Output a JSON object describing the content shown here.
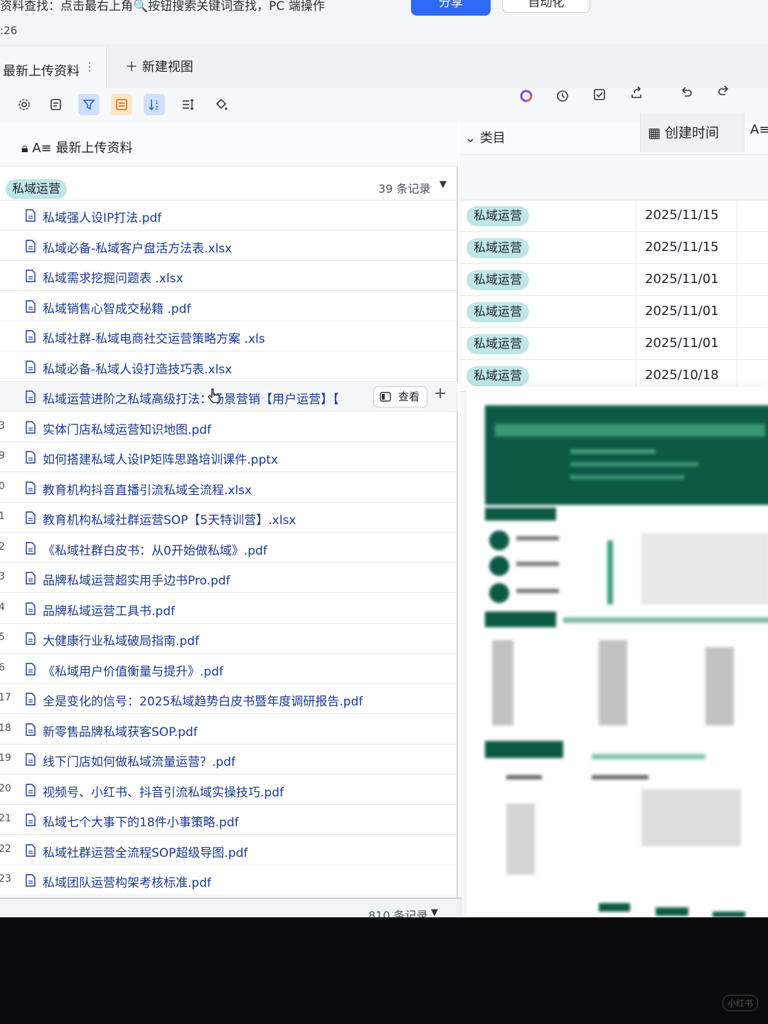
{
  "top": {
    "hint": "资料查找：点击最右上角🔍按钮搜索关键词查找，PC 端操作",
    "time": ":26",
    "share_label": "分享",
    "auto_label": "自动化"
  },
  "view": {
    "tab_label": "最新上传资料",
    "tab_more": "⋮",
    "new_view_label": "＋ 新建视图"
  },
  "table": {
    "primary_column": "最新上传资料",
    "columns": {
      "category": "类目",
      "created": "创建时间",
      "extra": "A≡"
    },
    "group": {
      "name": "私域运营",
      "count": "39 条记录"
    },
    "hover_view_label": "查看",
    "rows": [
      {
        "num": "",
        "name": "私域强人设IP打法.pdf",
        "category": "私域运营",
        "date": "2025/11/15"
      },
      {
        "num": "",
        "name": "私域必备-私域客户盘活方法表.xlsx",
        "category": "私域运营",
        "date": "2025/11/15"
      },
      {
        "num": "",
        "name": "私域需求挖掘问题表 .xlsx",
        "category": "私域运营",
        "date": "2025/11/01"
      },
      {
        "num": "",
        "name": "私域销售心智成交秘籍 .pdf",
        "category": "私域运营",
        "date": "2025/11/01"
      },
      {
        "num": "",
        "name": "私域社群-私域电商社交运营策略方案 .xls",
        "category": "私域运营",
        "date": "2025/11/01"
      },
      {
        "num": "",
        "name": "私域必备-私域人设打造技巧表.xlsx",
        "category": "私域运营",
        "date": "2025/10/18"
      },
      {
        "num": "",
        "name": "私域运营进阶之私域高级打法：场景营销【用户运营】【",
        "category": "",
        "date": ""
      },
      {
        "num": "3",
        "name": "实体门店私域运营知识地图.pdf",
        "category": "",
        "date": ""
      },
      {
        "num": "9",
        "name": "如何搭建私域人设IP矩阵思路培训课件.pptx",
        "category": "",
        "date": ""
      },
      {
        "num": "0",
        "name": "教育机构抖音直播引流私域全流程.xlsx",
        "category": "",
        "date": ""
      },
      {
        "num": "1",
        "name": "教育机构私域社群运营SOP【5天特训营】.xlsx",
        "category": "",
        "date": ""
      },
      {
        "num": "2",
        "name": "《私域社群白皮书：从0开始做私域》.pdf",
        "category": "",
        "date": ""
      },
      {
        "num": "3",
        "name": "品牌私域运营超实用手边书Pro.pdf",
        "category": "",
        "date": ""
      },
      {
        "num": "4",
        "name": "品牌私域运营工具书.pdf",
        "category": "",
        "date": ""
      },
      {
        "num": "5",
        "name": "大健康行业私域破局指南.pdf",
        "category": "",
        "date": ""
      },
      {
        "num": "6",
        "name": "《私域用户价值衡量与提升》.pdf",
        "category": "",
        "date": ""
      },
      {
        "num": "17",
        "name": "全是变化的信号：2025私域趋势白皮书暨年度调研报告.pdf",
        "category": "",
        "date": ""
      },
      {
        "num": "18",
        "name": "新零售品牌私域获客SOP.pdf",
        "category": "",
        "date": ""
      },
      {
        "num": "19",
        "name": "线下门店如何做私域流量运营？.pdf",
        "category": "",
        "date": ""
      },
      {
        "num": "20",
        "name": "视频号、小红书、抖音引流私域实操技巧.pdf",
        "category": "",
        "date": ""
      },
      {
        "num": "21",
        "name": "私域七个大事下的18件小事策略.pdf",
        "category": "",
        "date": ""
      },
      {
        "num": "22",
        "name": "私域社群运营全流程SOP超级导图.pdf",
        "category": "",
        "date": ""
      },
      {
        "num": "23",
        "name": "私域团队运营构架考核标准.pdf",
        "category": "",
        "date": ""
      }
    ],
    "footer_count": "810 条记录"
  },
  "colors": {
    "tag_bg": "#bfe6e6",
    "link_text": "#1b3a8f",
    "primary_blue": "#2f6af5",
    "preview_green": "#0c5a45"
  },
  "watermark": "小红书"
}
